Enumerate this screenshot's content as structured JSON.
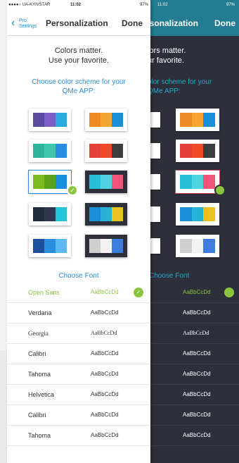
{
  "status": {
    "carrier": "●●●●○ UA-KYIVSTAR",
    "time": "11:02",
    "battery": "97%"
  },
  "nav": {
    "back_label": "Pro Settings",
    "title": "Personalization",
    "done_label": "Done"
  },
  "intro": {
    "line1": "Colors matter.",
    "line2": "Use your favorite."
  },
  "scheme": {
    "line1": "Choose color scheme for your",
    "line2": "QMe APP:",
    "swatches": [
      {
        "colors": [
          "#5a4aa0",
          "#7b5fc4",
          "#2ea8e0"
        ],
        "dark_bg": false,
        "selected": false
      },
      {
        "colors": [
          "#f08a24",
          "#f7a531",
          "#1b8dd6"
        ],
        "dark_bg": false,
        "selected": false
      },
      {
        "colors": [
          "#2eb39a",
          "#3fc7a8",
          "#2a8ee0"
        ],
        "dark_bg": false,
        "selected": false
      },
      {
        "colors": [
          "#e5413c",
          "#f04a28",
          "#3d3d3d"
        ],
        "dark_bg": false,
        "selected": false
      },
      {
        "colors": [
          "#7cba1f",
          "#5aa21a",
          "#1a8ddb"
        ],
        "dark_bg": false,
        "selected": true
      },
      {
        "colors": [
          "#26c0d8",
          "#4fd3e0",
          "#f0567a"
        ],
        "dark_bg": true,
        "selected": false
      },
      {
        "colors": [
          "#232a3a",
          "#2e3750",
          "#25c4d8"
        ],
        "dark_bg": false,
        "selected": false
      },
      {
        "colors": [
          "#1a8ddb",
          "#25b4d8",
          "#e6c31e"
        ],
        "dark_bg": true,
        "selected": false
      },
      {
        "colors": [
          "#1e4f9a",
          "#2a8ee0",
          "#5cb8f0"
        ],
        "dark_bg": false,
        "selected": false
      },
      {
        "colors": [
          "#cfcfcf",
          "#f2f2f2",
          "#3d7de0"
        ],
        "dark_bg": true,
        "selected": false
      }
    ]
  },
  "fonts": {
    "heading": "Choose Font",
    "sample": "AaBbCcDd",
    "items": [
      {
        "name": "Open Sans",
        "selected": true
      },
      {
        "name": "Verdana",
        "selected": false
      },
      {
        "name": "Georgia",
        "selected": false
      },
      {
        "name": "Calibri",
        "selected": false
      },
      {
        "name": "Tahoma",
        "selected": false
      },
      {
        "name": "Helvetica",
        "selected": false
      },
      {
        "name": "Calibri",
        "selected": false
      },
      {
        "name": "Tahoma",
        "selected": false
      }
    ]
  },
  "dark": {
    "title_fragment": "rsonalization",
    "intro_line1": "lors matter.",
    "intro_line2": "ur favorite.",
    "scheme_line1": "olor scheme for your",
    "scheme_line2": "QMe APP:",
    "font_heading": "Choose Font",
    "selected_font_fragment": "s"
  },
  "colors": {
    "accent_blue": "#2a8ee0",
    "accent_green": "#8bc53f",
    "dark_bg": "#2d2f3b",
    "dark_nav": "#247c92"
  }
}
